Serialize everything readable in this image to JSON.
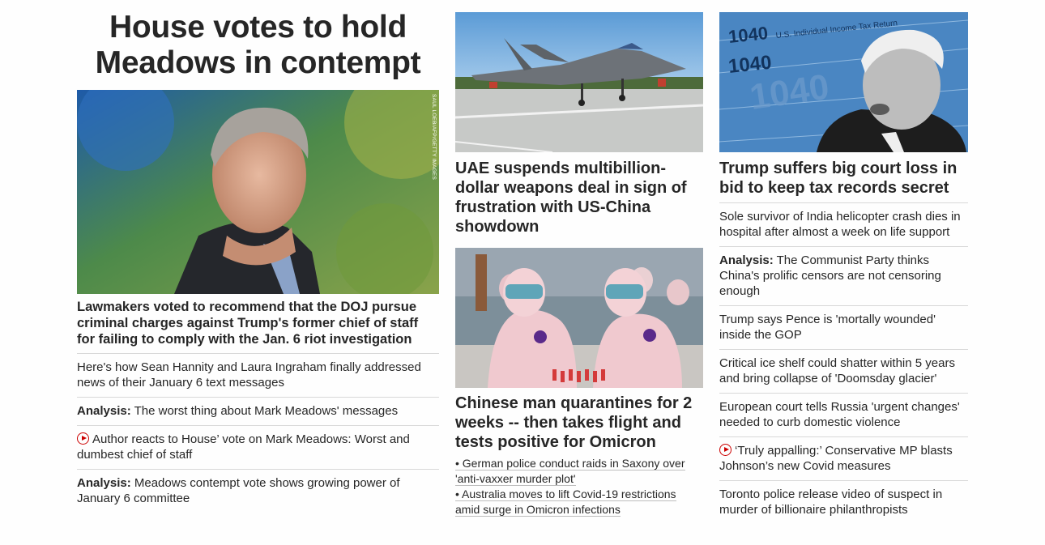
{
  "lead": {
    "headline": "House votes to hold Meadows in contempt",
    "photo_credit": "SAUL LOEB/AFP/GETTY IMAGES",
    "caption": "Lawmakers voted to recommend that the DOJ pursue criminal charges against Trump's former chief of staff for failing to comply with the Jan. 6 riot investigation",
    "related": [
      {
        "prefix": "",
        "text": "Here's how Sean Hannity and Laura Ingraham finally addressed news of their January 6 text messages",
        "video": false
      },
      {
        "prefix": "Analysis:",
        "text": " The worst thing about Mark Meadows' messages",
        "video": false
      },
      {
        "prefix": "",
        "text": "Author reacts to House’ vote on Mark Meadows: Worst and dumbest chief of staff",
        "video": true
      },
      {
        "prefix": "Analysis:",
        "text": " Meadows contempt vote shows growing power of January 6 committee",
        "video": false
      }
    ]
  },
  "middle": {
    "story1": {
      "headline": "UAE suspends multibillion-dollar weapons deal in sign of frustration with US-China showdown"
    },
    "story2": {
      "headline": "Chinese man quarantines for 2 weeks -- then takes flight and tests positive for Omicron",
      "sublinks": [
        "• German police conduct raids in Saxony over 'anti-vaxxer murder plot'",
        "• Australia moves to lift Covid-19 restrictions amid surge in Omicron infections"
      ]
    }
  },
  "right": {
    "headline": "Trump suffers big court loss in bid to keep tax records secret",
    "image_text": {
      "form": "1040",
      "label": "U.S. Individual Income Tax Return"
    },
    "items": [
      {
        "prefix": "",
        "text": "Sole survivor of India helicopter crash dies in hospital after almost a week on life support",
        "video": false
      },
      {
        "prefix": "Analysis:",
        "text": " The Communist Party thinks China's prolific censors are not censoring enough",
        "video": false
      },
      {
        "prefix": "",
        "text": "Trump says Pence is 'mortally wounded' inside the GOP",
        "video": false
      },
      {
        "prefix": "",
        "text": "Critical ice shelf could shatter within 5 years and bring collapse of 'Doomsday glacier'",
        "video": false
      },
      {
        "prefix": "",
        "text": "European court tells Russia 'urgent changes' needed to curb domestic violence",
        "video": false
      },
      {
        "prefix": "",
        "text": "‘Truly appalling:’ Conservative MP blasts Johnson’s new Covid measures",
        "video": true
      },
      {
        "prefix": "",
        "text": "Toronto police release video of suspect in murder of billionaire philanthropists",
        "video": false
      }
    ]
  },
  "colors": {
    "text": "#262626",
    "divider": "#d8d8d8",
    "video_red": "#cc0000"
  }
}
